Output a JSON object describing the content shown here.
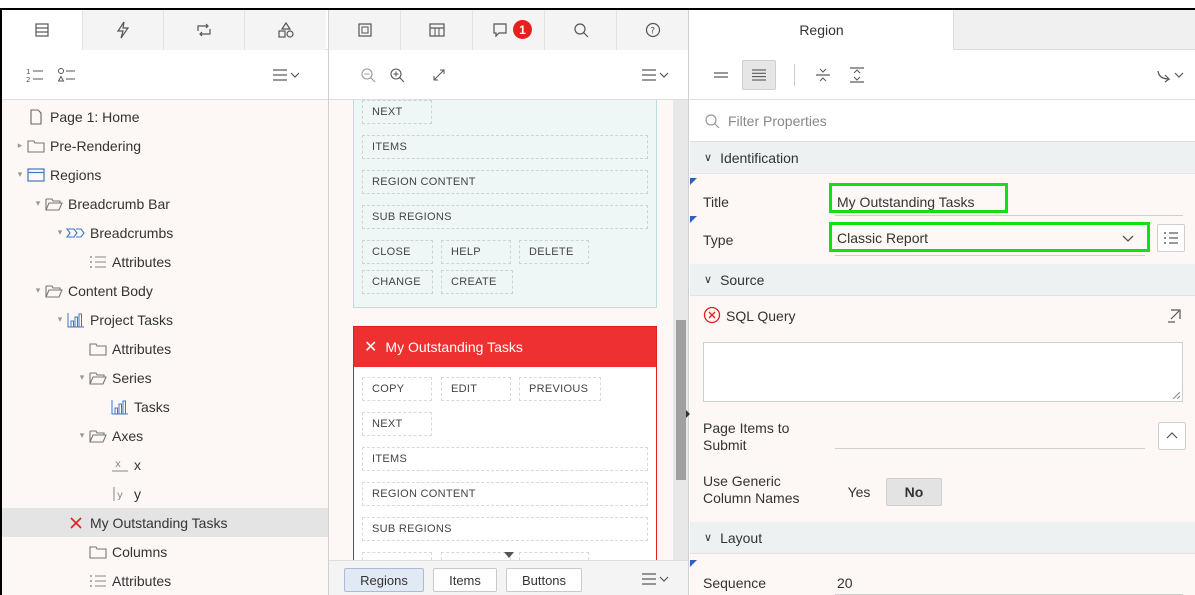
{
  "left": {
    "tabs": [
      {
        "icon": "rendering-tree-icon"
      },
      {
        "icon": "dynamic-actions-icon"
      },
      {
        "icon": "processing-icon"
      },
      {
        "icon": "shared-components-icon"
      }
    ],
    "toolbar": {
      "view_icon": "list-view-icon"
    },
    "tree": [
      {
        "label": "Page 1: Home",
        "icon": "page-icon",
        "depth": 0,
        "toggle": ""
      },
      {
        "label": "Pre-Rendering",
        "icon": "folder-icon",
        "depth": 0,
        "toggle": "▸"
      },
      {
        "label": "Regions",
        "icon": "regions-icon",
        "depth": 0,
        "toggle": "▾"
      },
      {
        "label": "Breadcrumb Bar",
        "icon": "folder-open-icon",
        "depth": 1,
        "toggle": "▾"
      },
      {
        "label": "Breadcrumbs",
        "icon": "breadcrumb-icon",
        "depth": 2,
        "toggle": "▾"
      },
      {
        "label": "Attributes",
        "icon": "attributes-icon",
        "depth": 3,
        "toggle": ""
      },
      {
        "label": "Content Body",
        "icon": "folder-open-icon",
        "depth": 1,
        "toggle": "▾"
      },
      {
        "label": "Project Tasks",
        "icon": "chart-icon",
        "depth": 2,
        "toggle": "▾"
      },
      {
        "label": "Attributes",
        "icon": "folder-icon",
        "depth": 3,
        "toggle": ""
      },
      {
        "label": "Series",
        "icon": "folder-open-icon",
        "depth": 3,
        "toggle": "▾"
      },
      {
        "label": "Tasks",
        "icon": "chart-icon",
        "depth": 4,
        "toggle": ""
      },
      {
        "label": "Axes",
        "icon": "folder-open-icon",
        "depth": 3,
        "toggle": "▾"
      },
      {
        "label": "x",
        "icon": "x-axis-icon",
        "depth": 4,
        "toggle": ""
      },
      {
        "label": "y",
        "icon": "y-axis-icon",
        "depth": 4,
        "toggle": ""
      },
      {
        "label": "My Outstanding Tasks",
        "icon": "error-x-icon",
        "depth": 2,
        "toggle": "",
        "selected": true
      },
      {
        "label": "Columns",
        "icon": "folder-icon",
        "depth": 3,
        "toggle": ""
      },
      {
        "label": "Attributes",
        "icon": "attributes-icon",
        "depth": 3,
        "toggle": ""
      }
    ]
  },
  "middle": {
    "tabs": [
      {
        "icon": "layout-icon"
      },
      {
        "icon": "gallery-icon"
      },
      {
        "icon": "messages-icon",
        "badge": "1"
      },
      {
        "icon": "search-icon"
      },
      {
        "icon": "help-icon"
      }
    ],
    "region1": {
      "slots": [
        "NEXT",
        "ITEMS",
        "REGION CONTENT",
        "SUB REGIONS",
        "CLOSE",
        "HELP",
        "DELETE",
        "CHANGE",
        "CREATE"
      ]
    },
    "region2": {
      "title": "My Outstanding Tasks",
      "slots": [
        "COPY",
        "EDIT",
        "PREVIOUS",
        "NEXT",
        "ITEMS",
        "REGION CONTENT",
        "SUB REGIONS"
      ]
    },
    "bottom": {
      "regions": "Regions",
      "items": "Items",
      "buttons": "Buttons"
    }
  },
  "right": {
    "tab": "Region",
    "filter_placeholder": "Filter Properties",
    "groups": {
      "identification": "Identification",
      "source": "Source",
      "layout": "Layout"
    },
    "title_label": "Title",
    "title_value": "My Outstanding Tasks",
    "type_label": "Type",
    "type_value": "Classic Report",
    "sql_label": "SQL Query",
    "page_items_label": [
      "Page Items to",
      "Submit"
    ],
    "generic_label": [
      "Use Generic",
      "Column Names"
    ],
    "generic_yes": "Yes",
    "generic_no": "No",
    "sequence_label": "Sequence",
    "sequence_value": "20",
    "colors": {
      "highlight": "#13e013",
      "error": "#ef3030"
    }
  }
}
